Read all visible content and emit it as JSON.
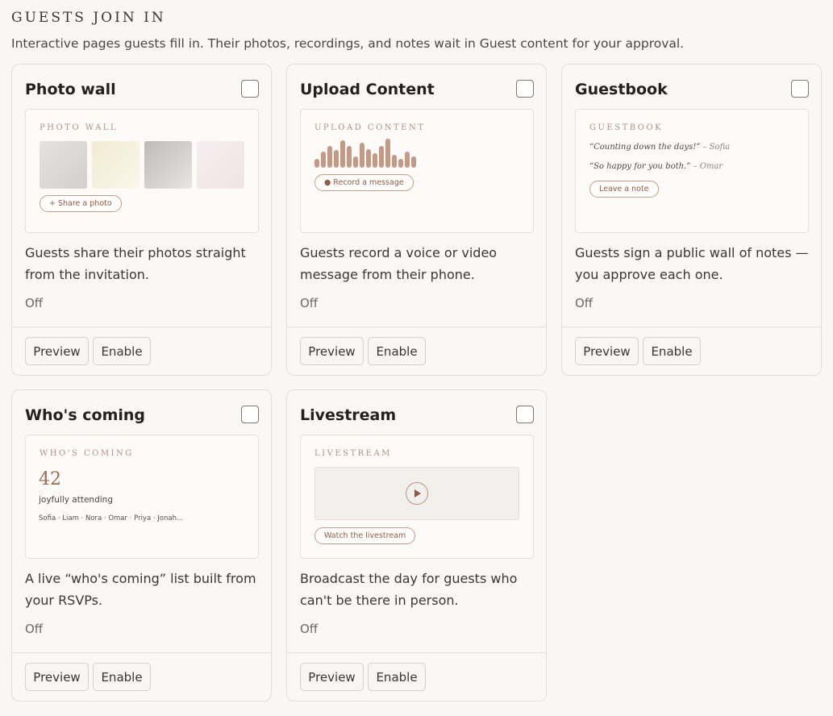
{
  "section": {
    "title": "GUESTS JOIN IN",
    "subtitle": "Interactive pages guests fill in. Their photos, recordings, and notes wait in Guest content for your approval."
  },
  "buttons": {
    "preview": "Preview",
    "enable": "Enable"
  },
  "cards": {
    "photo_wall": {
      "title": "Photo wall",
      "preview_label": "PHOTO WALL",
      "action": "+ Share a photo",
      "desc_line1": "Guests share their photos straight",
      "desc_line2": "from the invitation.",
      "status": "Off",
      "thumb_colors": [
        "#dcd9d6",
        "#f5f0dc",
        "#cfccc9",
        "#f4e9ea"
      ]
    },
    "upload_content": {
      "title": "Upload Content",
      "preview_label": "UPLOAD CONTENT",
      "action": "● Record a message",
      "desc_line1": "Guests record a voice or video",
      "desc_line2": "message from their phone.",
      "status": "Off",
      "waveform_levels": [
        0.3,
        0.55,
        0.75,
        0.6,
        0.95,
        0.75,
        0.4,
        0.85,
        0.65,
        0.5,
        0.75,
        1.0,
        0.45,
        0.3,
        0.55,
        0.4
      ]
    },
    "guestbook": {
      "title": "Guestbook",
      "preview_label": "GUESTBOOK",
      "quote1": "“Counting down the days!”",
      "quote1_author": "– Sofia",
      "quote2": "“So happy for you both.”",
      "quote2_author": "– Omar",
      "action": "Leave a note",
      "desc_line1": "Guests sign a public wall of notes —",
      "desc_line2": "you approve each one.",
      "status": "Off"
    },
    "whos_coming": {
      "title": "Who's coming",
      "preview_label": "WHO'S COMING",
      "count": "42",
      "attending": "joyfully attending",
      "names": "Sofia · Liam · Nora · Omar · Priya · Jonah...",
      "desc_line1": "A live “who's coming” list built from",
      "desc_line2": "your RSVPs.",
      "status": "Off"
    },
    "livestream": {
      "title": "Livestream",
      "preview_label": "LIVESTREAM",
      "action": "Watch the livestream",
      "desc_line1": "Broadcast the day for guests who",
      "desc_line2": "can't be there in person.",
      "status": "Off"
    }
  },
  "colors": {
    "accent": "#c49a84",
    "accent_text": "#8d5d48",
    "background": "#f8f7f4"
  }
}
